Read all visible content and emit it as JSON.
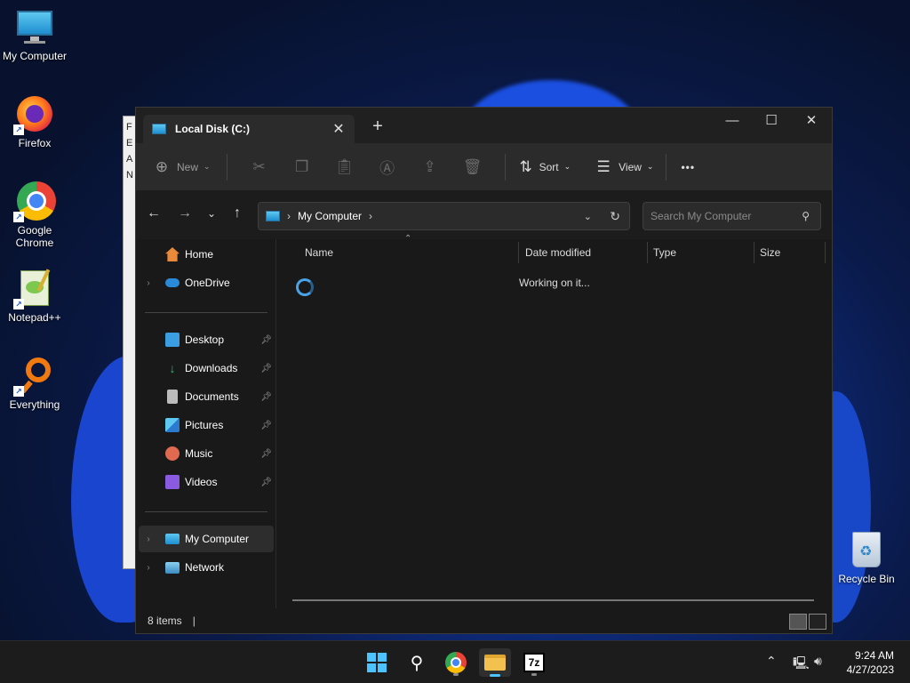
{
  "desktop": {
    "icons": [
      {
        "label": "My Computer",
        "icon": "monitor-icon"
      },
      {
        "label": "Firefox",
        "icon": "firefox-icon"
      },
      {
        "label": "Google\nChrome",
        "icon": "chrome-icon"
      },
      {
        "label": "Notepad++",
        "icon": "notepadpp-icon"
      },
      {
        "label": "Everything",
        "icon": "everything-icon"
      },
      {
        "label": "Recycle Bin",
        "icon": "recycle-bin-icon"
      }
    ]
  },
  "explorer": {
    "tab_title": "Local Disk (C:)",
    "toolbar": {
      "new_label": "New",
      "sort_label": "Sort",
      "view_label": "View",
      "more_label": "•••"
    },
    "address": {
      "location": "My Computer",
      "search_placeholder": "Search My Computer"
    },
    "nav": {
      "home": "Home",
      "onedrive": "OneDrive",
      "quick": [
        {
          "label": "Desktop",
          "icon": "desktop-folder-icon",
          "color": "#3a9ee0"
        },
        {
          "label": "Downloads",
          "icon": "download-arrow-icon",
          "color": "#2fb873"
        },
        {
          "label": "Documents",
          "icon": "document-icon",
          "color": "#bbbbbb"
        },
        {
          "label": "Pictures",
          "icon": "pictures-icon",
          "color": "#3a9ee0"
        },
        {
          "label": "Music",
          "icon": "music-icon",
          "color": "#e06a50"
        },
        {
          "label": "Videos",
          "icon": "videos-icon",
          "color": "#8a5ae0"
        }
      ],
      "my_computer": "My Computer",
      "network": "Network"
    },
    "columns": {
      "name": "Name",
      "date_modified": "Date modified",
      "type": "Type",
      "size": "Size"
    },
    "status_text": "Working on it...",
    "item_count": "8 items"
  },
  "taskbar": {
    "time": "9:24 AM",
    "date": "4/27/2023",
    "apps": [
      "start-icon",
      "search-icon",
      "chrome-icon",
      "file-explorer-icon",
      "7zip-icon"
    ]
  },
  "colors": {
    "accent": "#4cc2ff",
    "window_bg": "#191919",
    "toolbar_bg": "#2b2b2b"
  }
}
